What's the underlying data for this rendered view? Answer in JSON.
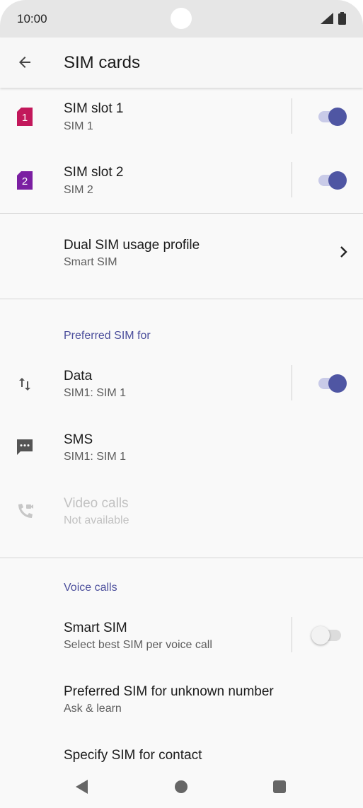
{
  "status_bar": {
    "time": "10:00"
  },
  "app_bar": {
    "title": "SIM cards"
  },
  "sim_slots": [
    {
      "title": "SIM slot 1",
      "subtitle": "SIM 1",
      "badge": "1",
      "badge_color": "#c2185b",
      "enabled": true
    },
    {
      "title": "SIM slot 2",
      "subtitle": "SIM 2",
      "badge": "2",
      "badge_color": "#7b1fa2",
      "enabled": true
    }
  ],
  "dual_sim": {
    "title": "Dual SIM usage profile",
    "subtitle": "Smart SIM"
  },
  "preferred": {
    "section_title": "Preferred SIM for",
    "data": {
      "title": "Data",
      "subtitle": "SIM1: SIM 1",
      "enabled": true
    },
    "sms": {
      "title": "SMS",
      "subtitle": "SIM1: SIM 1"
    },
    "video_calls": {
      "title": "Video calls",
      "subtitle": "Not available"
    }
  },
  "voice_calls": {
    "section_title": "Voice calls",
    "smart_sim": {
      "title": "Smart SIM",
      "subtitle": "Select best SIM per voice call",
      "enabled": false
    },
    "unknown_number": {
      "title": "Preferred SIM for unknown number",
      "subtitle": "Ask & learn"
    },
    "specify_contact": {
      "title": "Specify SIM for contact"
    }
  },
  "colors": {
    "accent": "#4f56a3",
    "section_text": "#4c4f9c",
    "disabled_text": "#c2c2c2"
  }
}
